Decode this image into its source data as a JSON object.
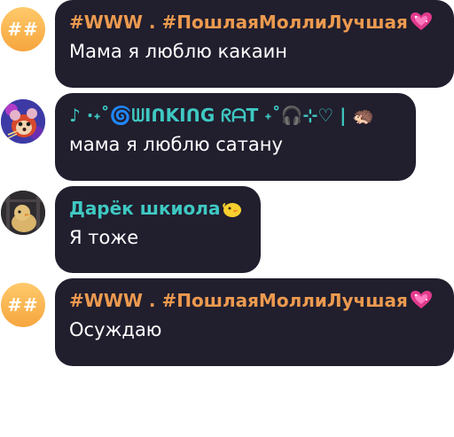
{
  "messages": [
    {
      "avatar_initials": "##",
      "name": "#WWW . #ПошлаяМоллиЛучшая",
      "name_icon": "sparkling-heart-icon",
      "text": "Мама я люблю какаин"
    },
    {
      "avatar_icon": "cartoon-rat-avatar",
      "name": "♪ ⋅˖˚🌀ᗯIᑎKIᑎG ᖇᗩT ˖˚🎧⊹♡ | 🦔",
      "text": "мама я люблю сатану"
    },
    {
      "avatar_icon": "chick-photo-avatar",
      "name": "Дарёк шкиола",
      "name_icon": "chick-emoji-icon",
      "text": "Я тоже"
    },
    {
      "avatar_initials": "##",
      "name": "#WWW . #ПошлаяМоллиЛучшая",
      "name_icon": "sparkling-heart-icon",
      "text": "Осуждаю"
    }
  ],
  "colors": {
    "bubble_bg": "#211e2e",
    "name_orange": "#ec9a4f",
    "name_teal": "#3ec9c2",
    "avatar_orange": "#f6a63e",
    "message_text": "#ffffff"
  }
}
